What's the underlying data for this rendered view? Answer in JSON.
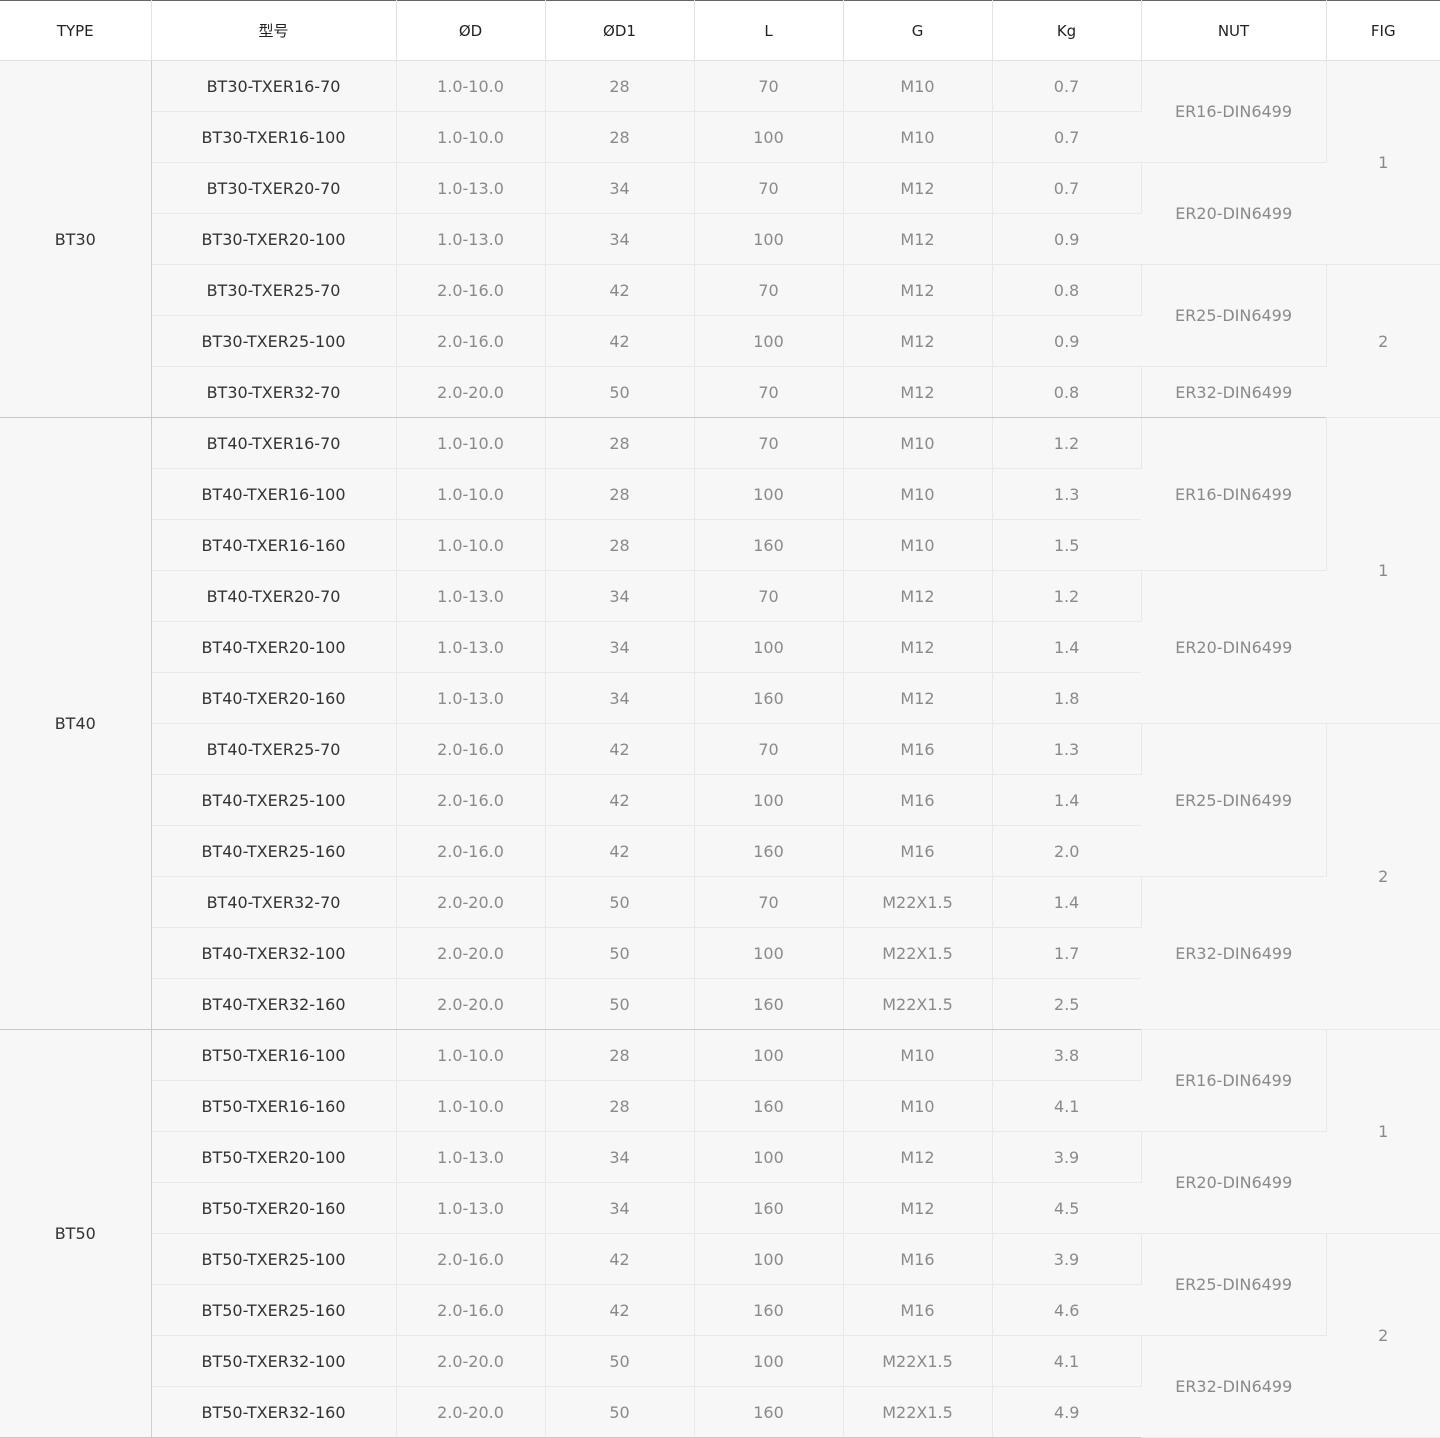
{
  "headers": [
    "TYPE",
    "型号",
    "ØD",
    "ØD1",
    "L",
    "G",
    "Kg",
    "NUT",
    "FIG"
  ],
  "groups": [
    {
      "type": "BT30",
      "rows": [
        [
          "BT30-TXER16-70",
          "1.0-10.0",
          "28",
          "70",
          "M10",
          "0.7"
        ],
        [
          "BT30-TXER16-100",
          "1.0-10.0",
          "28",
          "100",
          "M10",
          "0.7"
        ],
        [
          "BT30-TXER20-70",
          "1.0-13.0",
          "34",
          "70",
          "M12",
          "0.7"
        ],
        [
          "BT30-TXER20-100",
          "1.0-13.0",
          "34",
          "100",
          "M12",
          "0.9"
        ],
        [
          "BT30-TXER25-70",
          "2.0-16.0",
          "42",
          "70",
          "M12",
          "0.8"
        ],
        [
          "BT30-TXER25-100",
          "2.0-16.0",
          "42",
          "100",
          "M12",
          "0.9"
        ],
        [
          "BT30-TXER32-70",
          "2.0-20.0",
          "50",
          "70",
          "M12",
          "0.8"
        ]
      ],
      "nut": [
        {
          "label": "ER16-DIN6499",
          "span": 2
        },
        {
          "label": "ER20-DIN6499",
          "span": 2
        },
        {
          "label": "ER25-DIN6499",
          "span": 2
        },
        {
          "label": "ER32-DIN6499",
          "span": 1
        }
      ],
      "fig": [
        {
          "label": "1",
          "span": 4
        },
        {
          "label": "2",
          "span": 3
        }
      ]
    },
    {
      "type": "BT40",
      "rows": [
        [
          "BT40-TXER16-70",
          "1.0-10.0",
          "28",
          "70",
          "M10",
          "1.2"
        ],
        [
          "BT40-TXER16-100",
          "1.0-10.0",
          "28",
          "100",
          "M10",
          "1.3"
        ],
        [
          "BT40-TXER16-160",
          "1.0-10.0",
          "28",
          "160",
          "M10",
          "1.5"
        ],
        [
          "BT40-TXER20-70",
          "1.0-13.0",
          "34",
          "70",
          "M12",
          "1.2"
        ],
        [
          "BT40-TXER20-100",
          "1.0-13.0",
          "34",
          "100",
          "M12",
          "1.4"
        ],
        [
          "BT40-TXER20-160",
          "1.0-13.0",
          "34",
          "160",
          "M12",
          "1.8"
        ],
        [
          "BT40-TXER25-70",
          "2.0-16.0",
          "42",
          "70",
          "M16",
          "1.3"
        ],
        [
          "BT40-TXER25-100",
          "2.0-16.0",
          "42",
          "100",
          "M16",
          "1.4"
        ],
        [
          "BT40-TXER25-160",
          "2.0-16.0",
          "42",
          "160",
          "M16",
          "2.0"
        ],
        [
          "BT40-TXER32-70",
          "2.0-20.0",
          "50",
          "70",
          "M22X1.5",
          "1.4"
        ],
        [
          "BT40-TXER32-100",
          "2.0-20.0",
          "50",
          "100",
          "M22X1.5",
          "1.7"
        ],
        [
          "BT40-TXER32-160",
          "2.0-20.0",
          "50",
          "160",
          "M22X1.5",
          "2.5"
        ]
      ],
      "nut": [
        {
          "label": "ER16-DIN6499",
          "span": 3
        },
        {
          "label": "ER20-DIN6499",
          "span": 3
        },
        {
          "label": "ER25-DIN6499",
          "span": 3
        },
        {
          "label": "ER32-DIN6499",
          "span": 3
        }
      ],
      "fig": [
        {
          "label": "1",
          "span": 6
        },
        {
          "label": "2",
          "span": 6
        }
      ]
    },
    {
      "type": "BT50",
      "rows": [
        [
          "BT50-TXER16-100",
          "1.0-10.0",
          "28",
          "100",
          "M10",
          "3.8"
        ],
        [
          "BT50-TXER16-160",
          "1.0-10.0",
          "28",
          "160",
          "M10",
          "4.1"
        ],
        [
          "BT50-TXER20-100",
          "1.0-13.0",
          "34",
          "100",
          "M12",
          "3.9"
        ],
        [
          "BT50-TXER20-160",
          "1.0-13.0",
          "34",
          "160",
          "M12",
          "4.5"
        ],
        [
          "BT50-TXER25-100",
          "2.0-16.0",
          "42",
          "100",
          "M16",
          "3.9"
        ],
        [
          "BT50-TXER25-160",
          "2.0-16.0",
          "42",
          "160",
          "M16",
          "4.6"
        ],
        [
          "BT50-TXER32-100",
          "2.0-20.0",
          "50",
          "100",
          "M22X1.5",
          "4.1"
        ],
        [
          "BT50-TXER32-160",
          "2.0-20.0",
          "50",
          "160",
          "M22X1.5",
          "4.9"
        ]
      ],
      "nut": [
        {
          "label": "ER16-DIN6499",
          "span": 2
        },
        {
          "label": "ER20-DIN6499",
          "span": 2
        },
        {
          "label": "ER25-DIN6499",
          "span": 2
        },
        {
          "label": "ER32-DIN6499",
          "span": 2
        }
      ],
      "fig": [
        {
          "label": "1",
          "span": 4
        },
        {
          "label": "2",
          "span": 4
        }
      ]
    }
  ]
}
